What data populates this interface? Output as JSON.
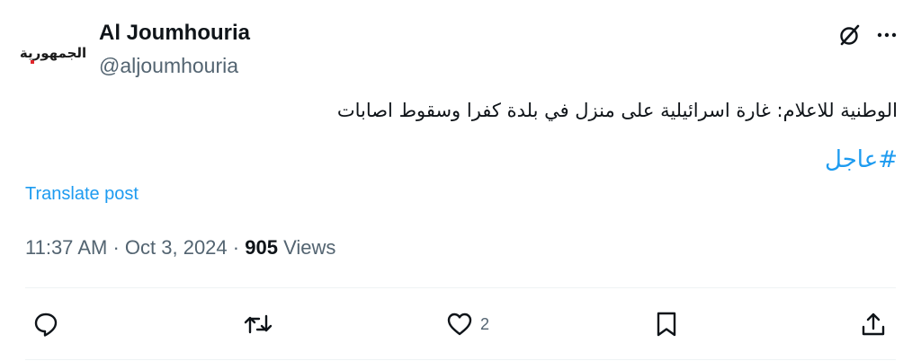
{
  "author": {
    "display_name": "Al Joumhouria",
    "handle": "@aljoumhouria",
    "avatar_logo_text": "الجمهورية"
  },
  "post": {
    "text": "الوطنية للاعلام: غارة اسرائيلية على منزل في بلدة كفرا وسقوط اصابات",
    "hashtag": "#عاجل",
    "translate_label": "Translate post"
  },
  "meta": {
    "time": "11:37 AM",
    "separator1": "·",
    "date": "Oct 3, 2024",
    "separator2": "·",
    "views_count": "905",
    "views_label": "Views"
  },
  "actions": {
    "like_count": "2"
  },
  "icons": {
    "header": [
      "grok-icon",
      "more-icon"
    ],
    "action_bar": [
      "reply-icon",
      "repost-icon",
      "like-icon",
      "bookmark-icon",
      "share-icon"
    ]
  },
  "colors": {
    "accent": "#1d9bf0",
    "secondary_text": "#536471",
    "primary_text": "#0f1419",
    "divider": "#eff3f4"
  }
}
